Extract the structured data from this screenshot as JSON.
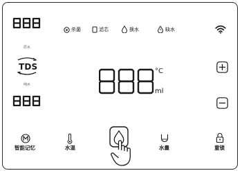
{
  "display": {
    "source_tds_digits": "888",
    "pure_tds_digits": "888",
    "main_digits": "888",
    "label_source_water": "原水",
    "label_pure_water": "纯水",
    "tds_label": "TDS",
    "unit_temp": "°C",
    "unit_volume": "ml"
  },
  "status_bar": {
    "items": [
      {
        "icon": "sterilize-icon",
        "label": "杀菌"
      },
      {
        "icon": "filter-icon",
        "label": "滤芯"
      },
      {
        "icon": "drop-icon",
        "label": "换水"
      },
      {
        "icon": "warning-drop-icon",
        "label": "缺水"
      }
    ],
    "wifi_icon": "wifi-icon"
  },
  "controls": {
    "plus_icon": "plus-icon",
    "minus_icon": "minus-icon"
  },
  "bottom_bar": {
    "items": [
      {
        "icon": "memory-icon",
        "label": "智能记忆"
      },
      {
        "icon": "thermometer-icon",
        "label": "水温"
      },
      {
        "icon": "water-drop-button-icon",
        "label": ""
      },
      {
        "icon": "cup-icon",
        "label": "水量"
      },
      {
        "icon": "lock-icon",
        "label": "童锁"
      }
    ]
  },
  "colors": {
    "ink": "#1a1a1a",
    "border": "#2a2a2a",
    "muted": "#6b6b6b"
  }
}
